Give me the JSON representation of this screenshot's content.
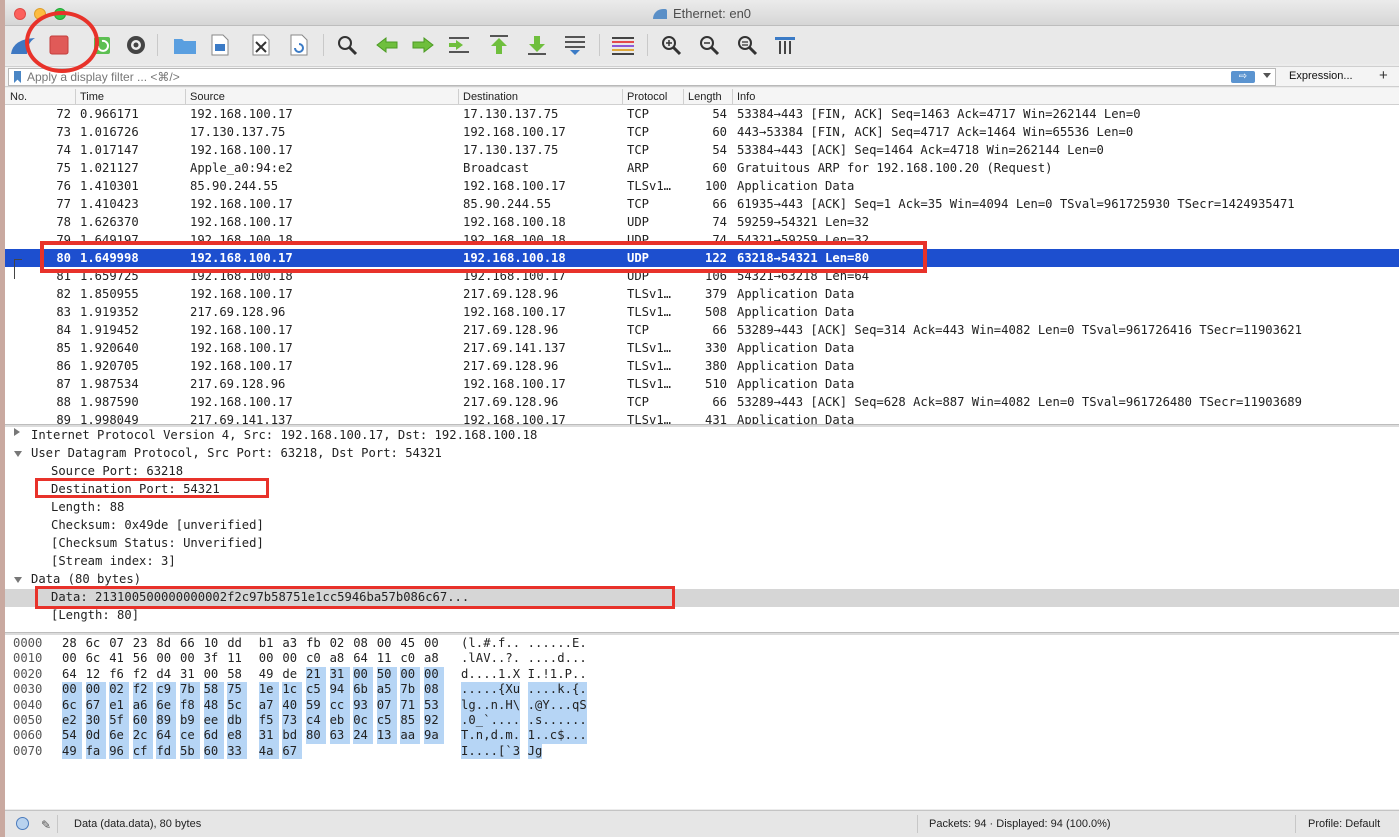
{
  "window": {
    "title": "Ethernet: en0"
  },
  "toolbar": {
    "icons": [
      "shark-fin-start-icon",
      "stop-capture-icon",
      "restart-capture-icon",
      "capture-options-icon",
      "open-file-icon",
      "save-file-icon",
      "close-file-icon",
      "reload-file-icon",
      "find-packet-icon",
      "go-back-icon",
      "go-forward-icon",
      "go-to-packet-icon",
      "first-packet-icon",
      "last-packet-icon",
      "autoscroll-icon",
      "colorize-icon",
      "zoom-in-icon",
      "zoom-out-icon",
      "normal-size-icon",
      "resize-columns-icon"
    ]
  },
  "filter": {
    "placeholder": "Apply a display filter ... <⌘/>",
    "arrow": "⇨",
    "expression_label": "Expression...",
    "plus": "+"
  },
  "packet_list": {
    "columns": [
      "No.",
      "Time",
      "Source",
      "Destination",
      "Protocol",
      "Length",
      "Info"
    ],
    "rows": [
      {
        "no": "72",
        "time": "0.966171",
        "src": "192.168.100.17",
        "dst": "17.130.137.75",
        "proto": "TCP",
        "len": "54",
        "info": "53384→443 [FIN, ACK] Seq=1463 Ack=4717 Win=262144 Len=0"
      },
      {
        "no": "73",
        "time": "1.016726",
        "src": "17.130.137.75",
        "dst": "192.168.100.17",
        "proto": "TCP",
        "len": "60",
        "info": "443→53384 [FIN, ACK] Seq=4717 Ack=1464 Win=65536 Len=0"
      },
      {
        "no": "74",
        "time": "1.017147",
        "src": "192.168.100.17",
        "dst": "17.130.137.75",
        "proto": "TCP",
        "len": "54",
        "info": "53384→443 [ACK] Seq=1464 Ack=4718 Win=262144 Len=0"
      },
      {
        "no": "75",
        "time": "1.021127",
        "src": "Apple_a0:94:e2",
        "dst": "Broadcast",
        "proto": "ARP",
        "len": "60",
        "info": "Gratuitous ARP for 192.168.100.20 (Request)"
      },
      {
        "no": "76",
        "time": "1.410301",
        "src": "85.90.244.55",
        "dst": "192.168.100.17",
        "proto": "TLSv1…",
        "len": "100",
        "info": "Application Data"
      },
      {
        "no": "77",
        "time": "1.410423",
        "src": "192.168.100.17",
        "dst": "85.90.244.55",
        "proto": "TCP",
        "len": "66",
        "info": "61935→443 [ACK] Seq=1 Ack=35 Win=4094 Len=0 TSval=961725930 TSecr=1424935471"
      },
      {
        "no": "78",
        "time": "1.626370",
        "src": "192.168.100.17",
        "dst": "192.168.100.18",
        "proto": "UDP",
        "len": "74",
        "info": "59259→54321 Len=32"
      },
      {
        "no": "79",
        "time": "1.649197",
        "src": "192.168.100.18",
        "dst": "192.168.100.18",
        "proto": "UDP",
        "len": "74",
        "info": "54321→59259 Len=32"
      },
      {
        "no": "80",
        "time": "1.649998",
        "src": "192.168.100.17",
        "dst": "192.168.100.18",
        "proto": "UDP",
        "len": "122",
        "info": "63218→54321 Len=80"
      },
      {
        "no": "81",
        "time": "1.659725",
        "src": "192.168.100.18",
        "dst": "192.168.100.17",
        "proto": "UDP",
        "len": "106",
        "info": "54321→63218 Len=64"
      },
      {
        "no": "82",
        "time": "1.850955",
        "src": "192.168.100.17",
        "dst": "217.69.128.96",
        "proto": "TLSv1…",
        "len": "379",
        "info": "Application Data"
      },
      {
        "no": "83",
        "time": "1.919352",
        "src": "217.69.128.96",
        "dst": "192.168.100.17",
        "proto": "TLSv1…",
        "len": "508",
        "info": "Application Data"
      },
      {
        "no": "84",
        "time": "1.919452",
        "src": "192.168.100.17",
        "dst": "217.69.128.96",
        "proto": "TCP",
        "len": "66",
        "info": "53289→443 [ACK] Seq=314 Ack=443 Win=4082 Len=0 TSval=961726416 TSecr=11903621"
      },
      {
        "no": "85",
        "time": "1.920640",
        "src": "192.168.100.17",
        "dst": "217.69.141.137",
        "proto": "TLSv1…",
        "len": "330",
        "info": "Application Data"
      },
      {
        "no": "86",
        "time": "1.920705",
        "src": "192.168.100.17",
        "dst": "217.69.128.96",
        "proto": "TLSv1…",
        "len": "380",
        "info": "Application Data"
      },
      {
        "no": "87",
        "time": "1.987534",
        "src": "217.69.128.96",
        "dst": "192.168.100.17",
        "proto": "TLSv1…",
        "len": "510",
        "info": "Application Data"
      },
      {
        "no": "88",
        "time": "1.987590",
        "src": "192.168.100.17",
        "dst": "217.69.128.96",
        "proto": "TCP",
        "len": "66",
        "info": "53289→443 [ACK] Seq=628 Ack=887 Win=4082 Len=0 TSval=961726480 TSecr=11903689"
      },
      {
        "no": "89",
        "time": "1.998049",
        "src": "217.69.141.137",
        "dst": "192.168.100.17",
        "proto": "TLSv1…",
        "len": "431",
        "info": "Application Data"
      }
    ]
  },
  "details": {
    "rows": [
      {
        "text": "Internet Protocol Version 4, Src: 192.168.100.17, Dst: 192.168.100.18"
      },
      {
        "text": "User Datagram Protocol, Src Port: 63218, Dst Port: 54321"
      },
      {
        "text": "Source Port: 63218"
      },
      {
        "text": "Destination Port: 54321"
      },
      {
        "text": "Length: 88"
      },
      {
        "text": "Checksum: 0x49de [unverified]"
      },
      {
        "text": "[Checksum Status: Unverified]"
      },
      {
        "text": "[Stream index: 3]"
      },
      {
        "text": "Data (80 bytes)"
      },
      {
        "text": "Data: 213100500000000002f2c97b58751e1cc5946ba57b086c67..."
      },
      {
        "text": "[Length: 80]"
      }
    ]
  },
  "hex": {
    "rows": [
      {
        "offset": "0000",
        "bytes": [
          "28",
          "6c",
          "07",
          "23",
          "8d",
          "66",
          "10",
          "dd",
          "b1",
          "a3",
          "fb",
          "02",
          "08",
          "00",
          "45",
          "00"
        ],
        "ascii": "(l.#.f.. ......E."
      },
      {
        "offset": "0010",
        "bytes": [
          "00",
          "6c",
          "41",
          "56",
          "00",
          "00",
          "3f",
          "11",
          "00",
          "00",
          "c0",
          "a8",
          "64",
          "11",
          "c0",
          "a8"
        ],
        "ascii": ".lAV..?. ....d..."
      },
      {
        "offset": "0020",
        "bytes": [
          "64",
          "12",
          "f6",
          "f2",
          "d4",
          "31",
          "00",
          "58",
          "49",
          "de",
          "21",
          "31",
          "00",
          "50",
          "00",
          "00"
        ],
        "ascii": "d....1.X I.!1.P.."
      },
      {
        "offset": "0030",
        "bytes": [
          "00",
          "00",
          "02",
          "f2",
          "c9",
          "7b",
          "58",
          "75",
          "1e",
          "1c",
          "c5",
          "94",
          "6b",
          "a5",
          "7b",
          "08"
        ],
        "ascii": ".....{Xu ....k.{."
      },
      {
        "offset": "0040",
        "bytes": [
          "6c",
          "67",
          "e1",
          "a6",
          "6e",
          "f8",
          "48",
          "5c",
          "a7",
          "40",
          "59",
          "cc",
          "93",
          "07",
          "71",
          "53"
        ],
        "ascii": "lg..n.H\\ .@Y...qS"
      },
      {
        "offset": "0050",
        "bytes": [
          "e2",
          "30",
          "5f",
          "60",
          "89",
          "b9",
          "ee",
          "db",
          "f5",
          "73",
          "c4",
          "eb",
          "0c",
          "c5",
          "85",
          "92"
        ],
        "ascii": ".0_`.... .s......"
      },
      {
        "offset": "0060",
        "bytes": [
          "54",
          "0d",
          "6e",
          "2c",
          "64",
          "ce",
          "6d",
          "e8",
          "31",
          "bd",
          "80",
          "63",
          "24",
          "13",
          "aa",
          "9a"
        ],
        "ascii": "T.n,d.m. 1..c$..."
      },
      {
        "offset": "0070",
        "bytes": [
          "49",
          "fa",
          "96",
          "cf",
          "fd",
          "5b",
          "60",
          "33",
          "4a",
          "67"
        ],
        "ascii": "I....[`3 Jg"
      }
    ]
  },
  "status": {
    "left": "Data (data.data), 80 bytes",
    "packets": "Packets: 94 · Displayed: 94 (100.0%)",
    "profile": "Profile: Default"
  },
  "colors": {
    "selection": "#1d4fcf",
    "annotation": "#e8322a",
    "hex_highlight": "#b6d5f5"
  }
}
